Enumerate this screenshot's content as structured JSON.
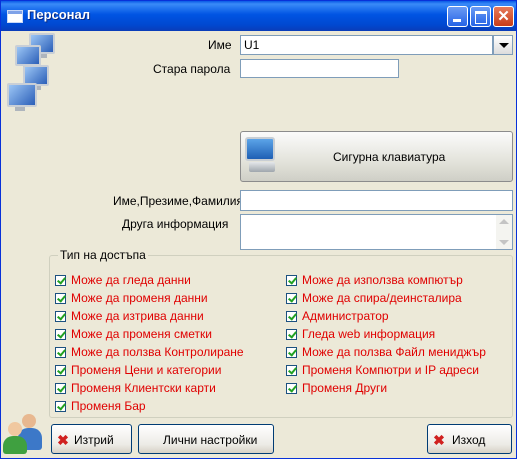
{
  "window": {
    "title": "Персонал"
  },
  "form": {
    "name_label": "Име",
    "name_value": "U1",
    "old_password_label": "Стара парола",
    "old_password_value": "",
    "secure_keyboard_label": "Сигурна клавиатура",
    "fullname_label": "Име,Презиме,Фамилия",
    "fullname_value": "",
    "other_info_label": "Друга информация",
    "other_info_value": ""
  },
  "access": {
    "legend": "Тип на достъпа",
    "left": [
      {
        "label": "Може да гледа данни",
        "checked": true
      },
      {
        "label": "Може да променя данни",
        "checked": true
      },
      {
        "label": "Може да изтрива данни",
        "checked": true
      },
      {
        "label": "Може да променя сметки",
        "checked": true
      },
      {
        "label": "Може да ползва Контролиране",
        "checked": true
      },
      {
        "label": "Променя Цени и категории",
        "checked": true
      },
      {
        "label": "Променя Клиентски карти",
        "checked": true
      },
      {
        "label": "Променя Бар",
        "checked": true
      }
    ],
    "right": [
      {
        "label": "Може да използва компютър",
        "checked": true
      },
      {
        "label": "Може да спира/деинсталира",
        "checked": true
      },
      {
        "label": "Администратор",
        "checked": true
      },
      {
        "label": "Гледа web информация",
        "checked": true
      },
      {
        "label": "Може да ползва Файл мениджър",
        "checked": true
      },
      {
        "label": "Променя Компютри и IP адреси",
        "checked": true
      },
      {
        "label": "Променя Други",
        "checked": true
      }
    ]
  },
  "buttons": {
    "delete": "Изтрий",
    "personal_settings": "Лични настройки",
    "exit": "Изход"
  },
  "colors": {
    "titlebar": "#0054E3",
    "checkbox_text": "#E00000",
    "background": "#ECE9D8"
  }
}
